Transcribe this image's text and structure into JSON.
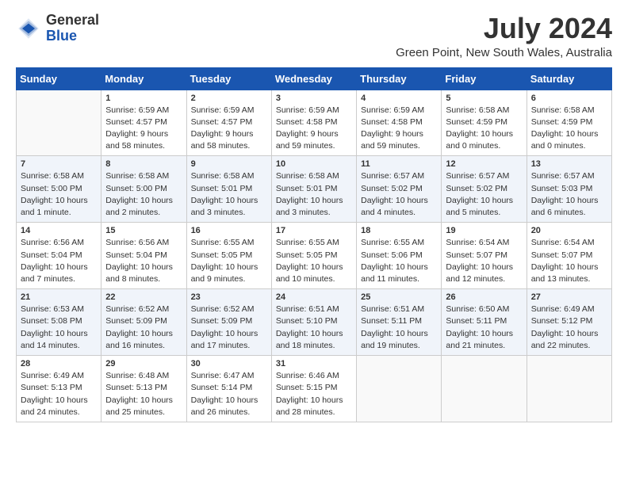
{
  "header": {
    "logo_general": "General",
    "logo_blue": "Blue",
    "month_title": "July 2024",
    "location": "Green Point, New South Wales, Australia"
  },
  "weekdays": [
    "Sunday",
    "Monday",
    "Tuesday",
    "Wednesday",
    "Thursday",
    "Friday",
    "Saturday"
  ],
  "weeks": [
    [
      {
        "day": "",
        "sunrise": "",
        "sunset": "",
        "daylight": ""
      },
      {
        "day": "1",
        "sunrise": "Sunrise: 6:59 AM",
        "sunset": "Sunset: 4:57 PM",
        "daylight": "Daylight: 9 hours and 58 minutes."
      },
      {
        "day": "2",
        "sunrise": "Sunrise: 6:59 AM",
        "sunset": "Sunset: 4:57 PM",
        "daylight": "Daylight: 9 hours and 58 minutes."
      },
      {
        "day": "3",
        "sunrise": "Sunrise: 6:59 AM",
        "sunset": "Sunset: 4:58 PM",
        "daylight": "Daylight: 9 hours and 59 minutes."
      },
      {
        "day": "4",
        "sunrise": "Sunrise: 6:59 AM",
        "sunset": "Sunset: 4:58 PM",
        "daylight": "Daylight: 9 hours and 59 minutes."
      },
      {
        "day": "5",
        "sunrise": "Sunrise: 6:58 AM",
        "sunset": "Sunset: 4:59 PM",
        "daylight": "Daylight: 10 hours and 0 minutes."
      },
      {
        "day": "6",
        "sunrise": "Sunrise: 6:58 AM",
        "sunset": "Sunset: 4:59 PM",
        "daylight": "Daylight: 10 hours and 0 minutes."
      }
    ],
    [
      {
        "day": "7",
        "sunrise": "Sunrise: 6:58 AM",
        "sunset": "Sunset: 5:00 PM",
        "daylight": "Daylight: 10 hours and 1 minute."
      },
      {
        "day": "8",
        "sunrise": "Sunrise: 6:58 AM",
        "sunset": "Sunset: 5:00 PM",
        "daylight": "Daylight: 10 hours and 2 minutes."
      },
      {
        "day": "9",
        "sunrise": "Sunrise: 6:58 AM",
        "sunset": "Sunset: 5:01 PM",
        "daylight": "Daylight: 10 hours and 3 minutes."
      },
      {
        "day": "10",
        "sunrise": "Sunrise: 6:58 AM",
        "sunset": "Sunset: 5:01 PM",
        "daylight": "Daylight: 10 hours and 3 minutes."
      },
      {
        "day": "11",
        "sunrise": "Sunrise: 6:57 AM",
        "sunset": "Sunset: 5:02 PM",
        "daylight": "Daylight: 10 hours and 4 minutes."
      },
      {
        "day": "12",
        "sunrise": "Sunrise: 6:57 AM",
        "sunset": "Sunset: 5:02 PM",
        "daylight": "Daylight: 10 hours and 5 minutes."
      },
      {
        "day": "13",
        "sunrise": "Sunrise: 6:57 AM",
        "sunset": "Sunset: 5:03 PM",
        "daylight": "Daylight: 10 hours and 6 minutes."
      }
    ],
    [
      {
        "day": "14",
        "sunrise": "Sunrise: 6:56 AM",
        "sunset": "Sunset: 5:04 PM",
        "daylight": "Daylight: 10 hours and 7 minutes."
      },
      {
        "day": "15",
        "sunrise": "Sunrise: 6:56 AM",
        "sunset": "Sunset: 5:04 PM",
        "daylight": "Daylight: 10 hours and 8 minutes."
      },
      {
        "day": "16",
        "sunrise": "Sunrise: 6:55 AM",
        "sunset": "Sunset: 5:05 PM",
        "daylight": "Daylight: 10 hours and 9 minutes."
      },
      {
        "day": "17",
        "sunrise": "Sunrise: 6:55 AM",
        "sunset": "Sunset: 5:05 PM",
        "daylight": "Daylight: 10 hours and 10 minutes."
      },
      {
        "day": "18",
        "sunrise": "Sunrise: 6:55 AM",
        "sunset": "Sunset: 5:06 PM",
        "daylight": "Daylight: 10 hours and 11 minutes."
      },
      {
        "day": "19",
        "sunrise": "Sunrise: 6:54 AM",
        "sunset": "Sunset: 5:07 PM",
        "daylight": "Daylight: 10 hours and 12 minutes."
      },
      {
        "day": "20",
        "sunrise": "Sunrise: 6:54 AM",
        "sunset": "Sunset: 5:07 PM",
        "daylight": "Daylight: 10 hours and 13 minutes."
      }
    ],
    [
      {
        "day": "21",
        "sunrise": "Sunrise: 6:53 AM",
        "sunset": "Sunset: 5:08 PM",
        "daylight": "Daylight: 10 hours and 14 minutes."
      },
      {
        "day": "22",
        "sunrise": "Sunrise: 6:52 AM",
        "sunset": "Sunset: 5:09 PM",
        "daylight": "Daylight: 10 hours and 16 minutes."
      },
      {
        "day": "23",
        "sunrise": "Sunrise: 6:52 AM",
        "sunset": "Sunset: 5:09 PM",
        "daylight": "Daylight: 10 hours and 17 minutes."
      },
      {
        "day": "24",
        "sunrise": "Sunrise: 6:51 AM",
        "sunset": "Sunset: 5:10 PM",
        "daylight": "Daylight: 10 hours and 18 minutes."
      },
      {
        "day": "25",
        "sunrise": "Sunrise: 6:51 AM",
        "sunset": "Sunset: 5:11 PM",
        "daylight": "Daylight: 10 hours and 19 minutes."
      },
      {
        "day": "26",
        "sunrise": "Sunrise: 6:50 AM",
        "sunset": "Sunset: 5:11 PM",
        "daylight": "Daylight: 10 hours and 21 minutes."
      },
      {
        "day": "27",
        "sunrise": "Sunrise: 6:49 AM",
        "sunset": "Sunset: 5:12 PM",
        "daylight": "Daylight: 10 hours and 22 minutes."
      }
    ],
    [
      {
        "day": "28",
        "sunrise": "Sunrise: 6:49 AM",
        "sunset": "Sunset: 5:13 PM",
        "daylight": "Daylight: 10 hours and 24 minutes."
      },
      {
        "day": "29",
        "sunrise": "Sunrise: 6:48 AM",
        "sunset": "Sunset: 5:13 PM",
        "daylight": "Daylight: 10 hours and 25 minutes."
      },
      {
        "day": "30",
        "sunrise": "Sunrise: 6:47 AM",
        "sunset": "Sunset: 5:14 PM",
        "daylight": "Daylight: 10 hours and 26 minutes."
      },
      {
        "day": "31",
        "sunrise": "Sunrise: 6:46 AM",
        "sunset": "Sunset: 5:15 PM",
        "daylight": "Daylight: 10 hours and 28 minutes."
      },
      {
        "day": "",
        "sunrise": "",
        "sunset": "",
        "daylight": ""
      },
      {
        "day": "",
        "sunrise": "",
        "sunset": "",
        "daylight": ""
      },
      {
        "day": "",
        "sunrise": "",
        "sunset": "",
        "daylight": ""
      }
    ]
  ]
}
